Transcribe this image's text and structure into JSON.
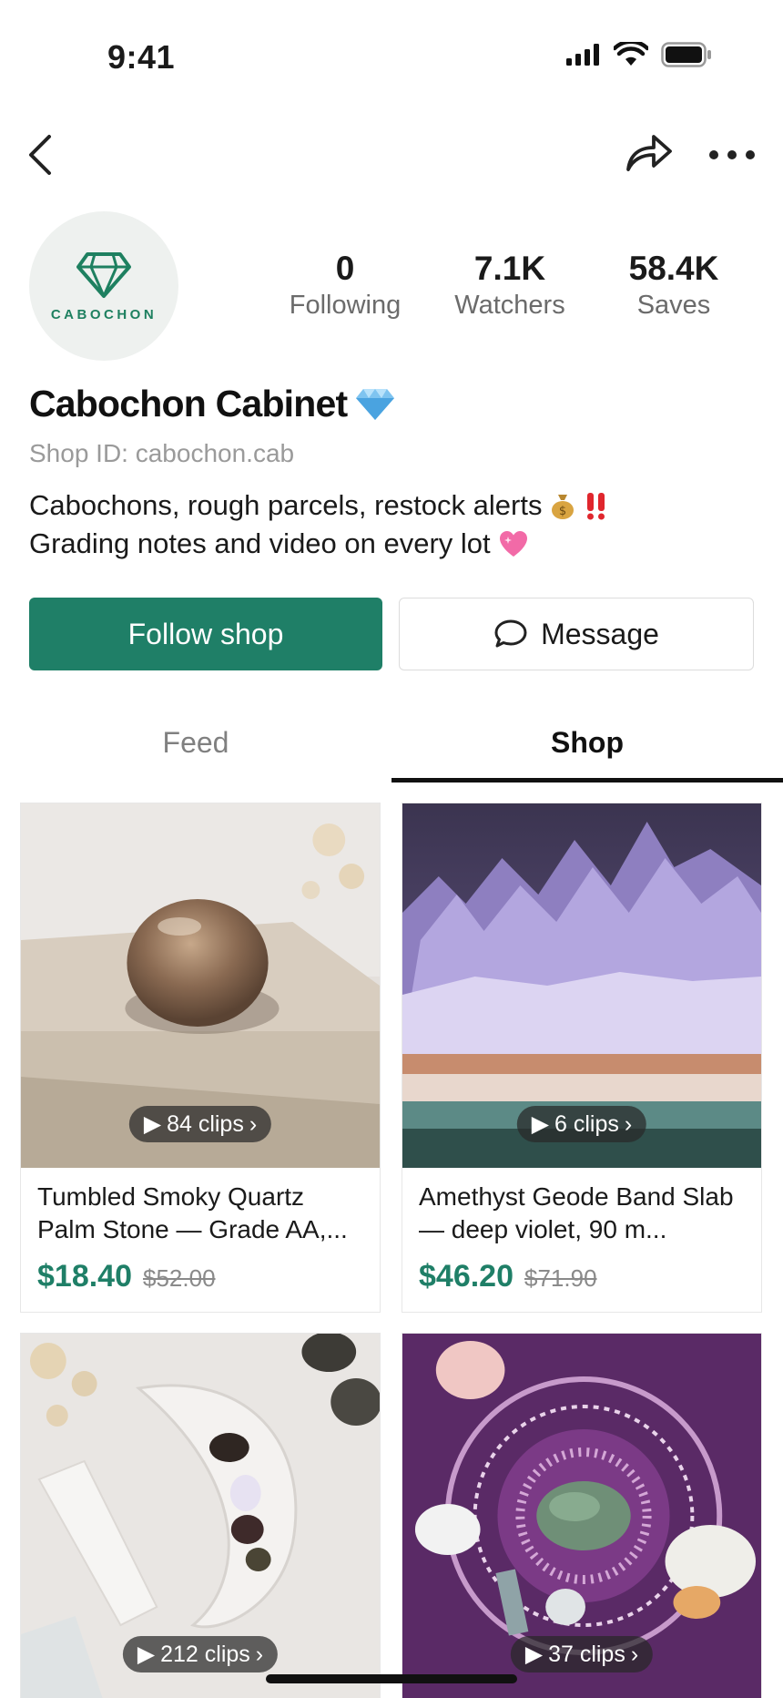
{
  "status_bar": {
    "time": "9:41"
  },
  "profile": {
    "avatar_logo_text": "CABOCHON",
    "name": "Cabochon Cabinet",
    "shop_id": "Shop ID: cabochon.cab",
    "bio_line1": "Cabochons, rough parcels, restock alerts",
    "bio_line2": "Grading notes and video on every lot",
    "stats": [
      {
        "value": "0",
        "label": "Following"
      },
      {
        "value": "7.1K",
        "label": "Watchers"
      },
      {
        "value": "58.4K",
        "label": "Saves"
      }
    ]
  },
  "actions": {
    "follow_label": "Follow shop",
    "message_label": "Message"
  },
  "tabs": [
    {
      "label": "Feed",
      "active": false
    },
    {
      "label": "Shop",
      "active": true
    }
  ],
  "products": [
    {
      "clips": "84 clips",
      "title": "Tumbled Smoky Quartz Palm Stone — Grade AA,...",
      "price": "$18.40",
      "original_price": "$52.00"
    },
    {
      "clips": "6 clips",
      "title": "Amethyst Geode Band Slab — deep violet, 90 m...",
      "price": "$46.20",
      "original_price": "$71.90"
    },
    {
      "clips": "212 clips"
    },
    {
      "clips": "37 clips"
    }
  ],
  "colors": {
    "accent": "#1f7f67",
    "tab_active": "#111111"
  }
}
